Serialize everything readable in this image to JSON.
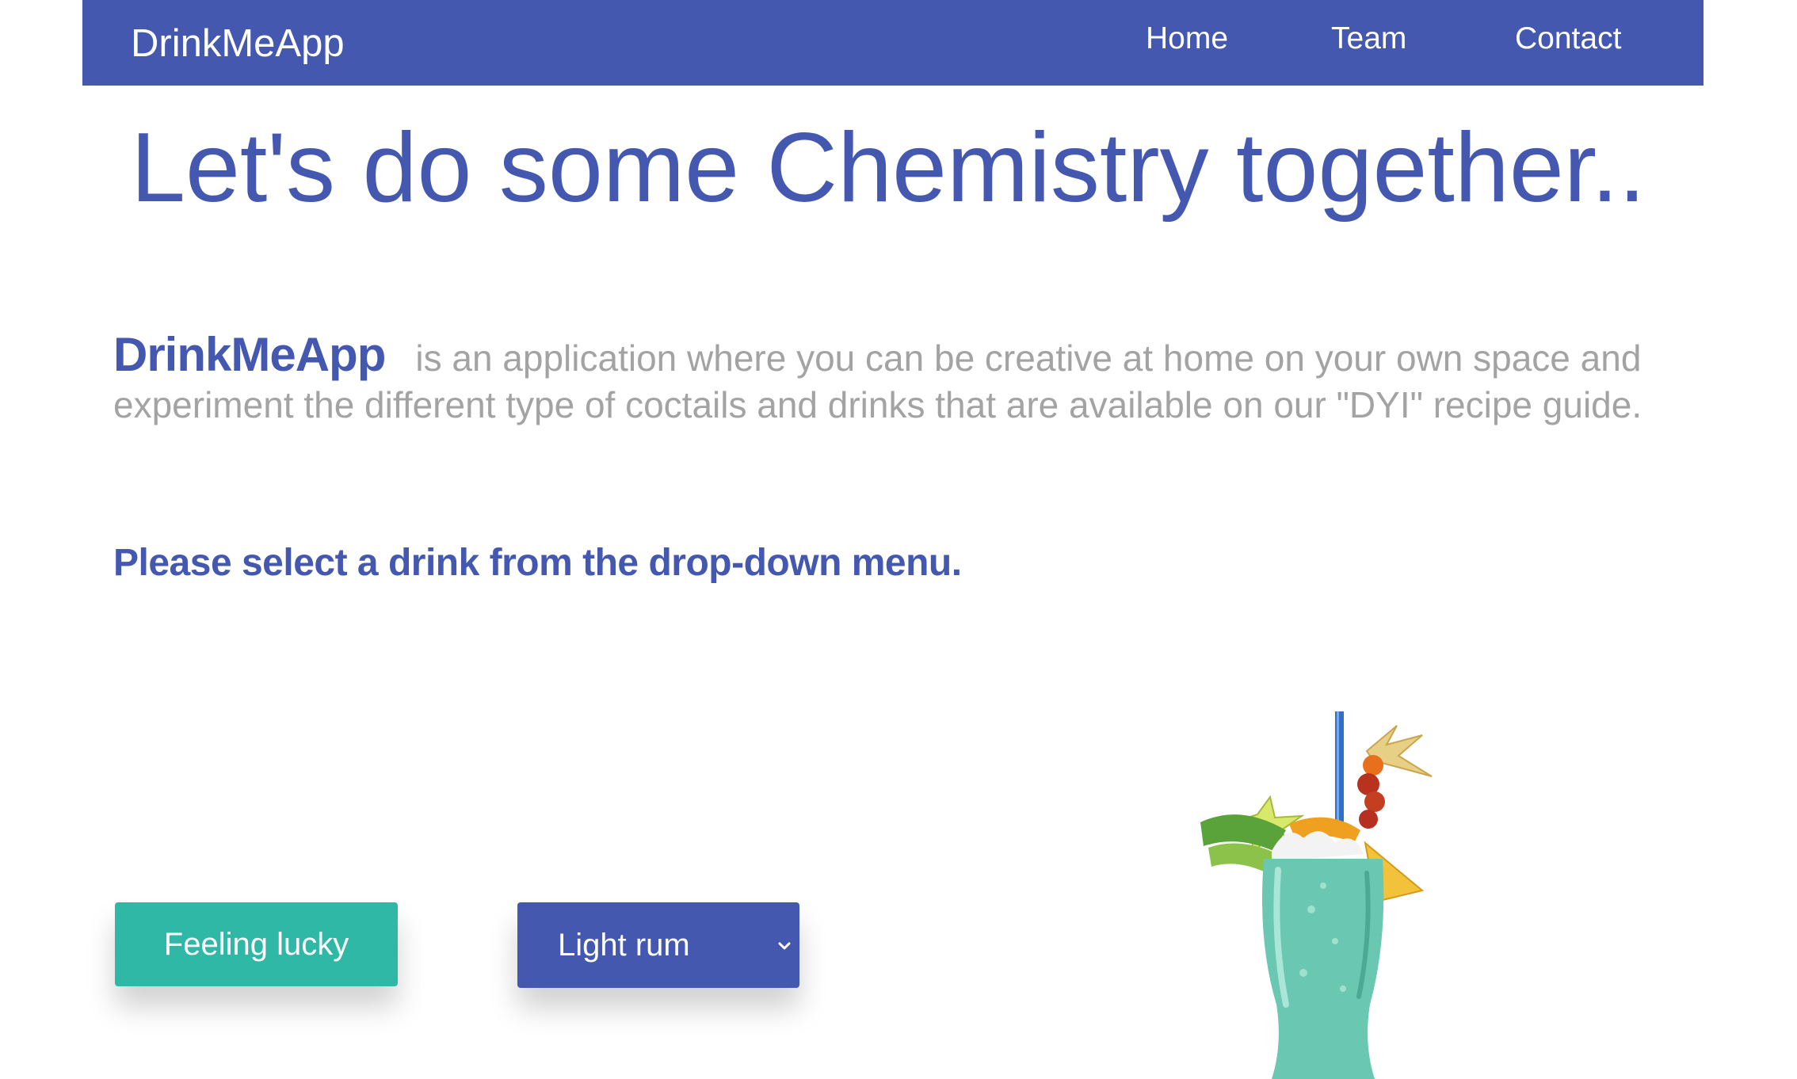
{
  "nav": {
    "brand": "DrinkMeApp",
    "links": [
      {
        "label": "Home"
      },
      {
        "label": "Team"
      },
      {
        "label": "Contact"
      }
    ]
  },
  "hero": {
    "title": "Let's do some Chemistry together.."
  },
  "intro": {
    "brand": "DrinkMeApp",
    "text": "is an application where you can be creative at home on your own space and experiment the different type of coctails and drinks that are available on our \"DYI\" recipe guide."
  },
  "prompt": {
    "text": "Please select a drink from the drop-down menu."
  },
  "controls": {
    "lucky_label": "Feeling lucky",
    "drink_select": {
      "selected": "Light rum"
    }
  },
  "image": {
    "subject": "tropical cocktail in tall glass with fruit garnish and straw"
  },
  "colors": {
    "primary": "#4458b0",
    "accent": "#2fb8a6",
    "muted_text": "#a3a3a3",
    "background": "#ffffff"
  }
}
